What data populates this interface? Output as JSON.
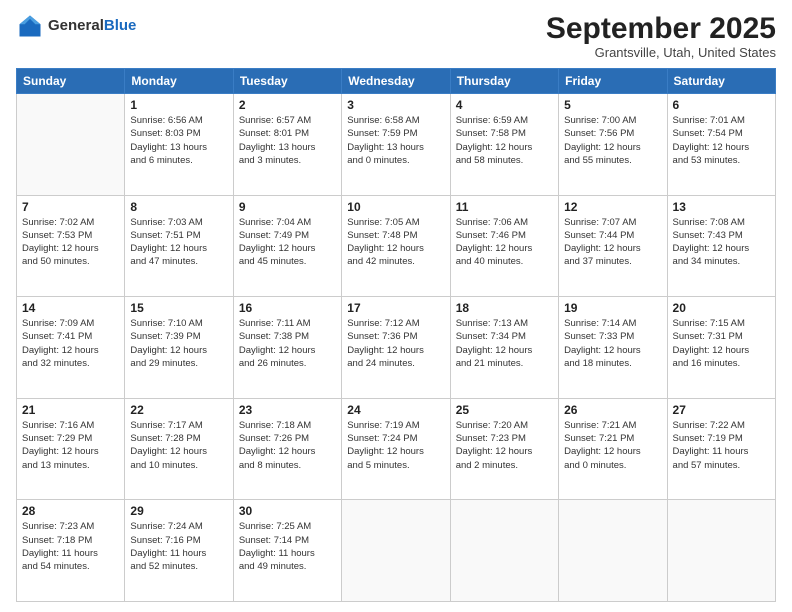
{
  "header": {
    "logo_general": "General",
    "logo_blue": "Blue",
    "month_title": "September 2025",
    "subtitle": "Grantsville, Utah, United States"
  },
  "days_of_week": [
    "Sunday",
    "Monday",
    "Tuesday",
    "Wednesday",
    "Thursday",
    "Friday",
    "Saturday"
  ],
  "weeks": [
    [
      {
        "day": "",
        "info": ""
      },
      {
        "day": "1",
        "info": "Sunrise: 6:56 AM\nSunset: 8:03 PM\nDaylight: 13 hours\nand 6 minutes."
      },
      {
        "day": "2",
        "info": "Sunrise: 6:57 AM\nSunset: 8:01 PM\nDaylight: 13 hours\nand 3 minutes."
      },
      {
        "day": "3",
        "info": "Sunrise: 6:58 AM\nSunset: 7:59 PM\nDaylight: 13 hours\nand 0 minutes."
      },
      {
        "day": "4",
        "info": "Sunrise: 6:59 AM\nSunset: 7:58 PM\nDaylight: 12 hours\nand 58 minutes."
      },
      {
        "day": "5",
        "info": "Sunrise: 7:00 AM\nSunset: 7:56 PM\nDaylight: 12 hours\nand 55 minutes."
      },
      {
        "day": "6",
        "info": "Sunrise: 7:01 AM\nSunset: 7:54 PM\nDaylight: 12 hours\nand 53 minutes."
      }
    ],
    [
      {
        "day": "7",
        "info": "Sunrise: 7:02 AM\nSunset: 7:53 PM\nDaylight: 12 hours\nand 50 minutes."
      },
      {
        "day": "8",
        "info": "Sunrise: 7:03 AM\nSunset: 7:51 PM\nDaylight: 12 hours\nand 47 minutes."
      },
      {
        "day": "9",
        "info": "Sunrise: 7:04 AM\nSunset: 7:49 PM\nDaylight: 12 hours\nand 45 minutes."
      },
      {
        "day": "10",
        "info": "Sunrise: 7:05 AM\nSunset: 7:48 PM\nDaylight: 12 hours\nand 42 minutes."
      },
      {
        "day": "11",
        "info": "Sunrise: 7:06 AM\nSunset: 7:46 PM\nDaylight: 12 hours\nand 40 minutes."
      },
      {
        "day": "12",
        "info": "Sunrise: 7:07 AM\nSunset: 7:44 PM\nDaylight: 12 hours\nand 37 minutes."
      },
      {
        "day": "13",
        "info": "Sunrise: 7:08 AM\nSunset: 7:43 PM\nDaylight: 12 hours\nand 34 minutes."
      }
    ],
    [
      {
        "day": "14",
        "info": "Sunrise: 7:09 AM\nSunset: 7:41 PM\nDaylight: 12 hours\nand 32 minutes."
      },
      {
        "day": "15",
        "info": "Sunrise: 7:10 AM\nSunset: 7:39 PM\nDaylight: 12 hours\nand 29 minutes."
      },
      {
        "day": "16",
        "info": "Sunrise: 7:11 AM\nSunset: 7:38 PM\nDaylight: 12 hours\nand 26 minutes."
      },
      {
        "day": "17",
        "info": "Sunrise: 7:12 AM\nSunset: 7:36 PM\nDaylight: 12 hours\nand 24 minutes."
      },
      {
        "day": "18",
        "info": "Sunrise: 7:13 AM\nSunset: 7:34 PM\nDaylight: 12 hours\nand 21 minutes."
      },
      {
        "day": "19",
        "info": "Sunrise: 7:14 AM\nSunset: 7:33 PM\nDaylight: 12 hours\nand 18 minutes."
      },
      {
        "day": "20",
        "info": "Sunrise: 7:15 AM\nSunset: 7:31 PM\nDaylight: 12 hours\nand 16 minutes."
      }
    ],
    [
      {
        "day": "21",
        "info": "Sunrise: 7:16 AM\nSunset: 7:29 PM\nDaylight: 12 hours\nand 13 minutes."
      },
      {
        "day": "22",
        "info": "Sunrise: 7:17 AM\nSunset: 7:28 PM\nDaylight: 12 hours\nand 10 minutes."
      },
      {
        "day": "23",
        "info": "Sunrise: 7:18 AM\nSunset: 7:26 PM\nDaylight: 12 hours\nand 8 minutes."
      },
      {
        "day": "24",
        "info": "Sunrise: 7:19 AM\nSunset: 7:24 PM\nDaylight: 12 hours\nand 5 minutes."
      },
      {
        "day": "25",
        "info": "Sunrise: 7:20 AM\nSunset: 7:23 PM\nDaylight: 12 hours\nand 2 minutes."
      },
      {
        "day": "26",
        "info": "Sunrise: 7:21 AM\nSunset: 7:21 PM\nDaylight: 12 hours\nand 0 minutes."
      },
      {
        "day": "27",
        "info": "Sunrise: 7:22 AM\nSunset: 7:19 PM\nDaylight: 11 hours\nand 57 minutes."
      }
    ],
    [
      {
        "day": "28",
        "info": "Sunrise: 7:23 AM\nSunset: 7:18 PM\nDaylight: 11 hours\nand 54 minutes."
      },
      {
        "day": "29",
        "info": "Sunrise: 7:24 AM\nSunset: 7:16 PM\nDaylight: 11 hours\nand 52 minutes."
      },
      {
        "day": "30",
        "info": "Sunrise: 7:25 AM\nSunset: 7:14 PM\nDaylight: 11 hours\nand 49 minutes."
      },
      {
        "day": "",
        "info": ""
      },
      {
        "day": "",
        "info": ""
      },
      {
        "day": "",
        "info": ""
      },
      {
        "day": "",
        "info": ""
      }
    ]
  ]
}
